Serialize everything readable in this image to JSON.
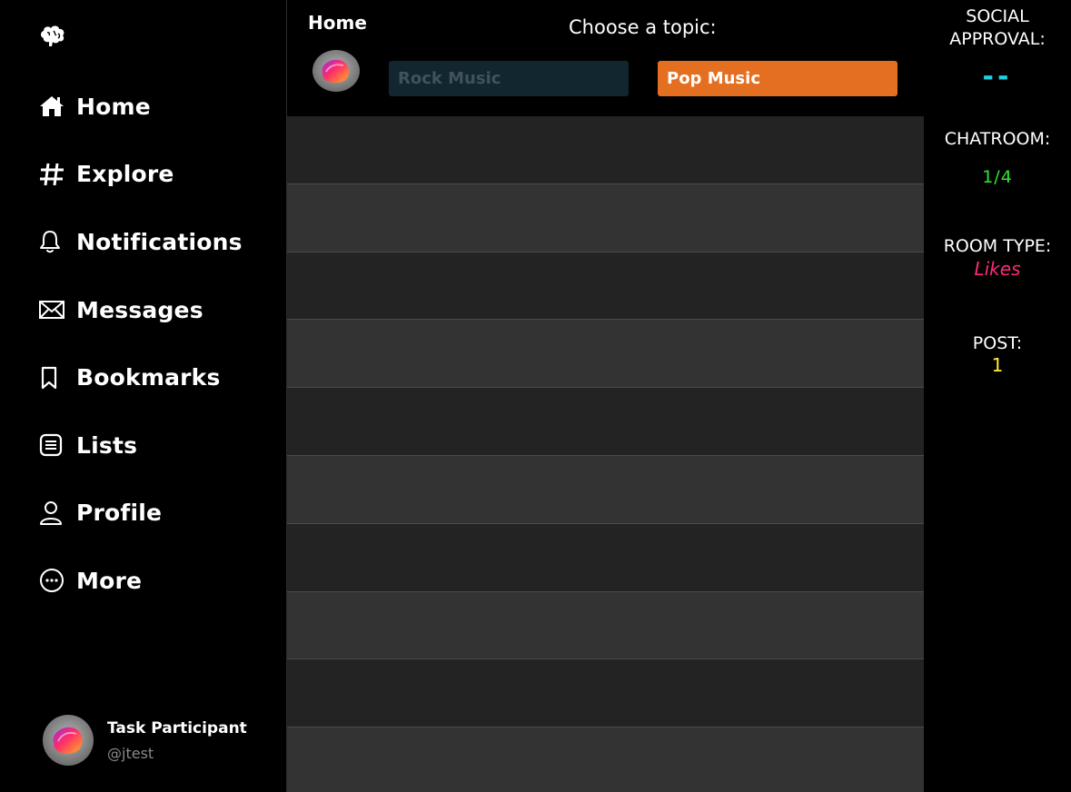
{
  "sidebar": {
    "logo_icon": "brain-icon",
    "items": [
      {
        "label": "Home",
        "icon": "house-icon"
      },
      {
        "label": "Explore",
        "icon": "hashtag-icon"
      },
      {
        "label": "Notifications",
        "icon": "bell-icon"
      },
      {
        "label": "Messages",
        "icon": "envelope-icon"
      },
      {
        "label": "Bookmarks",
        "icon": "bookmark-icon"
      },
      {
        "label": "Lists",
        "icon": "list-icon"
      },
      {
        "label": "Profile",
        "icon": "person-icon"
      },
      {
        "label": "More",
        "icon": "ellipsis-circle-icon"
      }
    ],
    "user": {
      "name": "Task Participant",
      "handle": "@jtest"
    }
  },
  "header": {
    "title": "Home",
    "prompt": "Choose a topic:",
    "topics": [
      {
        "label": "Rock Music",
        "state": "inactive",
        "color": "#12262f"
      },
      {
        "label": "Pop Music",
        "state": "active",
        "color": "#e56f21"
      }
    ]
  },
  "feed": {
    "row_count": 10
  },
  "status": {
    "approval_label": "SOCIAL APPROVAL:",
    "approval_value": "--",
    "approval_color": "#1fd2e0",
    "chatroom_label": "CHATROOM:",
    "chatroom_value": "1/4",
    "chatroom_color": "#2ee82e",
    "room_type_label": "ROOM TYPE:",
    "room_type_value": "Likes",
    "room_type_color": "#ff2a7a",
    "post_label": "POST:",
    "post_value": "1",
    "post_color": "#ffee33"
  }
}
